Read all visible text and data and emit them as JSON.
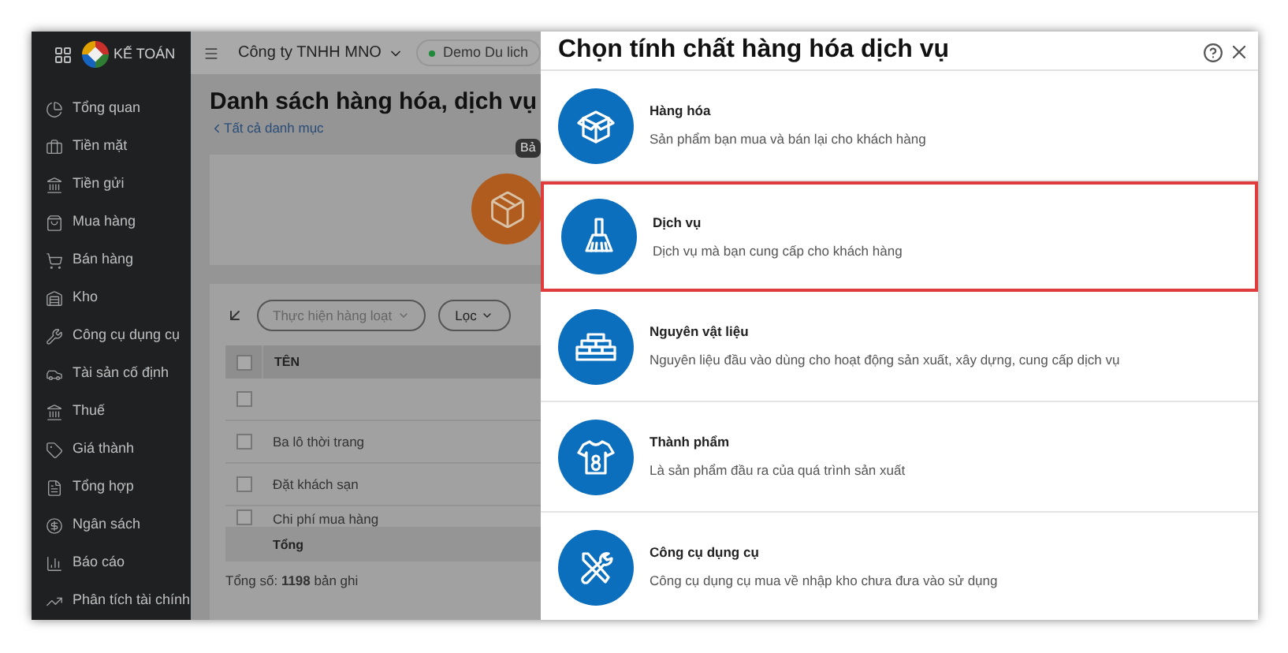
{
  "app": {
    "logo_text": "KẾ TOÁN"
  },
  "sidebar": {
    "items": [
      {
        "label": "Tổng quan"
      },
      {
        "label": "Tiền mặt"
      },
      {
        "label": "Tiền gửi"
      },
      {
        "label": "Mua hàng"
      },
      {
        "label": "Bán hàng"
      },
      {
        "label": "Kho"
      },
      {
        "label": "Công cụ dụng cụ"
      },
      {
        "label": "Tài sản cố định"
      },
      {
        "label": "Thuế"
      },
      {
        "label": "Giá thành"
      },
      {
        "label": "Tổng hợp"
      },
      {
        "label": "Ngân sách"
      },
      {
        "label": "Báo cáo"
      },
      {
        "label": "Phân tích tài chính"
      }
    ]
  },
  "header": {
    "company": "Công ty TNHH MNO",
    "database": "Demo Du lich"
  },
  "page": {
    "title": "Danh sách hàng hóa, dịch vụ",
    "back_link": "Tất cả danh mục",
    "tooltip": "Bả",
    "toolbar": {
      "bulk_action": "Thực hiện hàng loạt",
      "filter": "Lọc"
    },
    "table": {
      "columns": [
        "TÊN"
      ],
      "select_all_checked": false,
      "rows": [
        {
          "name": "",
          "checked": false
        },
        {
          "name": "Ba lô thời trang",
          "checked": false
        },
        {
          "name": "Đặt khách sạn",
          "checked": false
        },
        {
          "name": "Chi phí mua hàng",
          "checked": false
        }
      ],
      "footer": "Tổng"
    },
    "total": "Tổng số: **1198** bản ghi"
  },
  "dialog": {
    "title": "Chọn tính chất hàng hóa dịch vụ",
    "options": [
      {
        "kind": "goods",
        "title": "Hàng hóa",
        "description": "Sản phẩm bạn mua và bán lại cho khách hàng",
        "selected": false
      },
      {
        "kind": "service",
        "title": "Dịch vụ",
        "description": "Dịch vụ mà bạn cung cấp cho khách hàng",
        "selected": true
      },
      {
        "kind": "material",
        "title": "Nguyên vật liệu",
        "description": "Nguyên liệu đầu vào dùng cho hoạt động sản xuất, xây dựng, cung cấp dịch vụ",
        "selected": false
      },
      {
        "kind": "product",
        "title": "Thành phẩm",
        "description": "Là sản phẩm đầu ra của quá trình sản xuất",
        "selected": false
      },
      {
        "kind": "tool",
        "title": "Công cụ dụng cụ",
        "description": "Công cụ dụng cụ mua về nhập kho chưa đưa vào sử dụng",
        "selected": false
      }
    ]
  }
}
